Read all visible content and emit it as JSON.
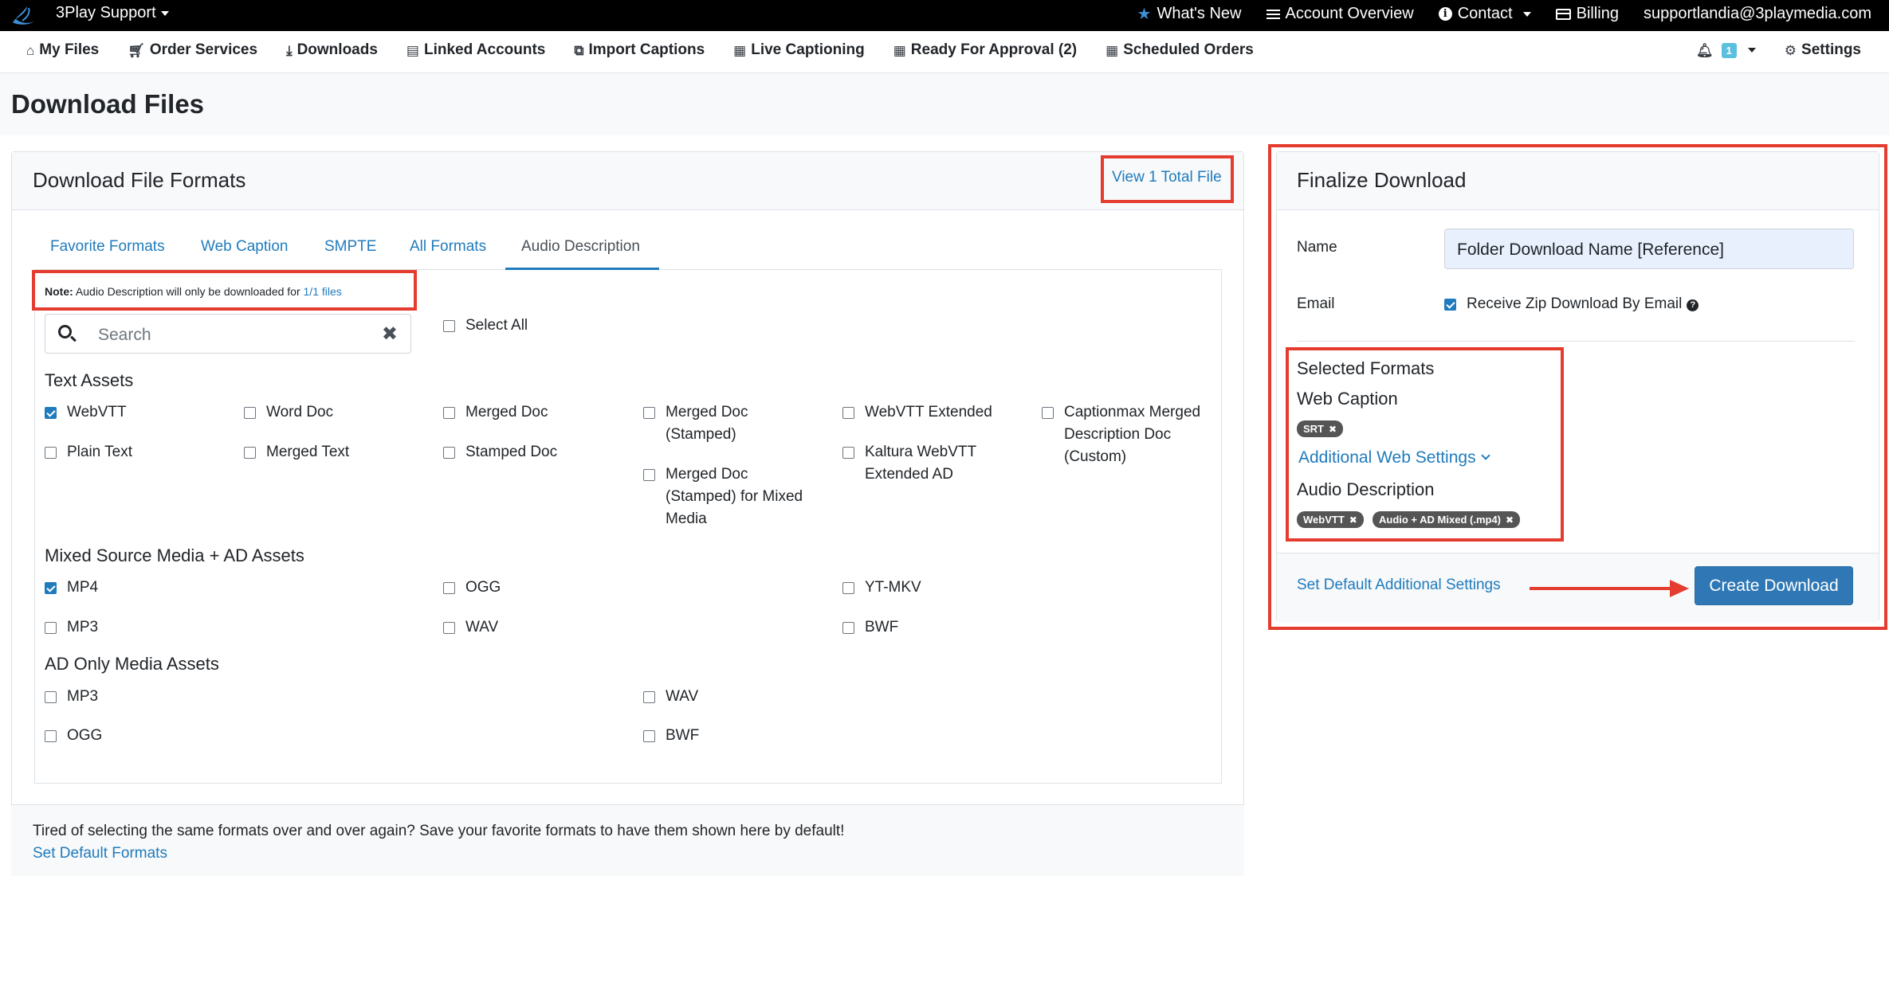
{
  "topbar": {
    "brand": "3Play Support",
    "links": [
      {
        "label": "What's New",
        "icon": "star-icon"
      },
      {
        "label": "Account Overview",
        "icon": "list-icon"
      },
      {
        "label": "Contact",
        "icon": "info-icon"
      },
      {
        "label": "Billing",
        "icon": "credit-card-icon"
      },
      {
        "label": "supportlandia@3playmedia.com",
        "icon": ""
      }
    ]
  },
  "mainnav": {
    "items": [
      {
        "label": "My Files",
        "icon": "home-icon"
      },
      {
        "label": "Order Services",
        "icon": "cart-icon"
      },
      {
        "label": "Downloads",
        "icon": "download-icon"
      },
      {
        "label": "Linked Accounts",
        "icon": "id-card-icon"
      },
      {
        "label": "Import Captions",
        "icon": "external-link-icon"
      },
      {
        "label": "Live Captioning",
        "icon": "calendar-icon"
      },
      {
        "label": "Ready For Approval (2)",
        "icon": "calendar-icon"
      },
      {
        "label": "Scheduled Orders",
        "icon": "calendar-plus-icon"
      }
    ],
    "notifications_count": "1",
    "settings_label": "Settings"
  },
  "page": {
    "title": "Download Files"
  },
  "formats_card": {
    "title": "Download File Formats",
    "view_total": "View 1 Total File",
    "tabs": [
      "Favorite Formats",
      "Web Caption",
      "SMPTE",
      "All Formats",
      "Audio Description"
    ],
    "active_tab": "Audio Description",
    "note_bold": "Note:",
    "note_text": "Audio Description will only be downloaded for",
    "note_link": "1/1 files",
    "search_placeholder": "Search",
    "select_all": "Select All",
    "sections": {
      "text_assets": "Text Assets",
      "mixed_assets": "Mixed Source Media + AD Assets",
      "ad_only": "AD Only Media Assets"
    },
    "text_assets": [
      {
        "label": "WebVTT",
        "checked": true
      },
      {
        "label": "Word Doc",
        "checked": false
      },
      {
        "label": "Merged Doc",
        "checked": false
      },
      {
        "label": "Merged Doc\n(Stamped)",
        "checked": false
      },
      {
        "label": "WebVTT Extended",
        "checked": false
      },
      {
        "label": "Captionmax Merged\nDescription Doc\n(Custom)",
        "checked": false
      },
      {
        "label": "Plain Text",
        "checked": false
      },
      {
        "label": "Merged Text",
        "checked": false
      },
      {
        "label": "Stamped Doc",
        "checked": false
      },
      {
        "label": "Merged Doc\n(Stamped) for Mixed\nMedia",
        "checked": false
      },
      {
        "label": "Kaltura WebVTT\nExtended AD",
        "checked": false
      }
    ],
    "mixed_assets": [
      {
        "label": "MP4",
        "checked": true
      },
      {
        "label": "OGG",
        "checked": false
      },
      {
        "label": "YT-MKV",
        "checked": false
      },
      {
        "label": "MP3",
        "checked": false
      },
      {
        "label": "WAV",
        "checked": false
      },
      {
        "label": "BWF",
        "checked": false
      }
    ],
    "ad_only": [
      {
        "label": "MP3",
        "checked": false
      },
      {
        "label": "WAV",
        "checked": false
      },
      {
        "label": "OGG",
        "checked": false
      },
      {
        "label": "BWF",
        "checked": false
      }
    ],
    "footer_text": "Tired of selecting the same formats over and over again? Save your favorite formats to have them shown here by default!",
    "footer_link": "Set Default Formats"
  },
  "finalize_card": {
    "title": "Finalize Download",
    "name_label": "Name",
    "name_value": "Folder Download Name [Reference]",
    "email_label": "Email",
    "email_option": "Receive Zip Download By Email",
    "email_checked": true,
    "selected_formats_title": "Selected Formats",
    "web_caption_title": "Web Caption",
    "web_caption_pills": [
      "SRT"
    ],
    "additional_web_settings": "Additional Web Settings",
    "audio_description_title": "Audio Description",
    "audio_description_pills": [
      "WebVTT",
      "Audio + AD Mixed (.mp4)"
    ],
    "set_default_link": "Set Default Additional Settings",
    "create_button": "Create Download"
  },
  "colors": {
    "annotation_red": "#e43c2f",
    "link_blue": "#1f7bbd",
    "primary_button": "#2f78b5"
  }
}
